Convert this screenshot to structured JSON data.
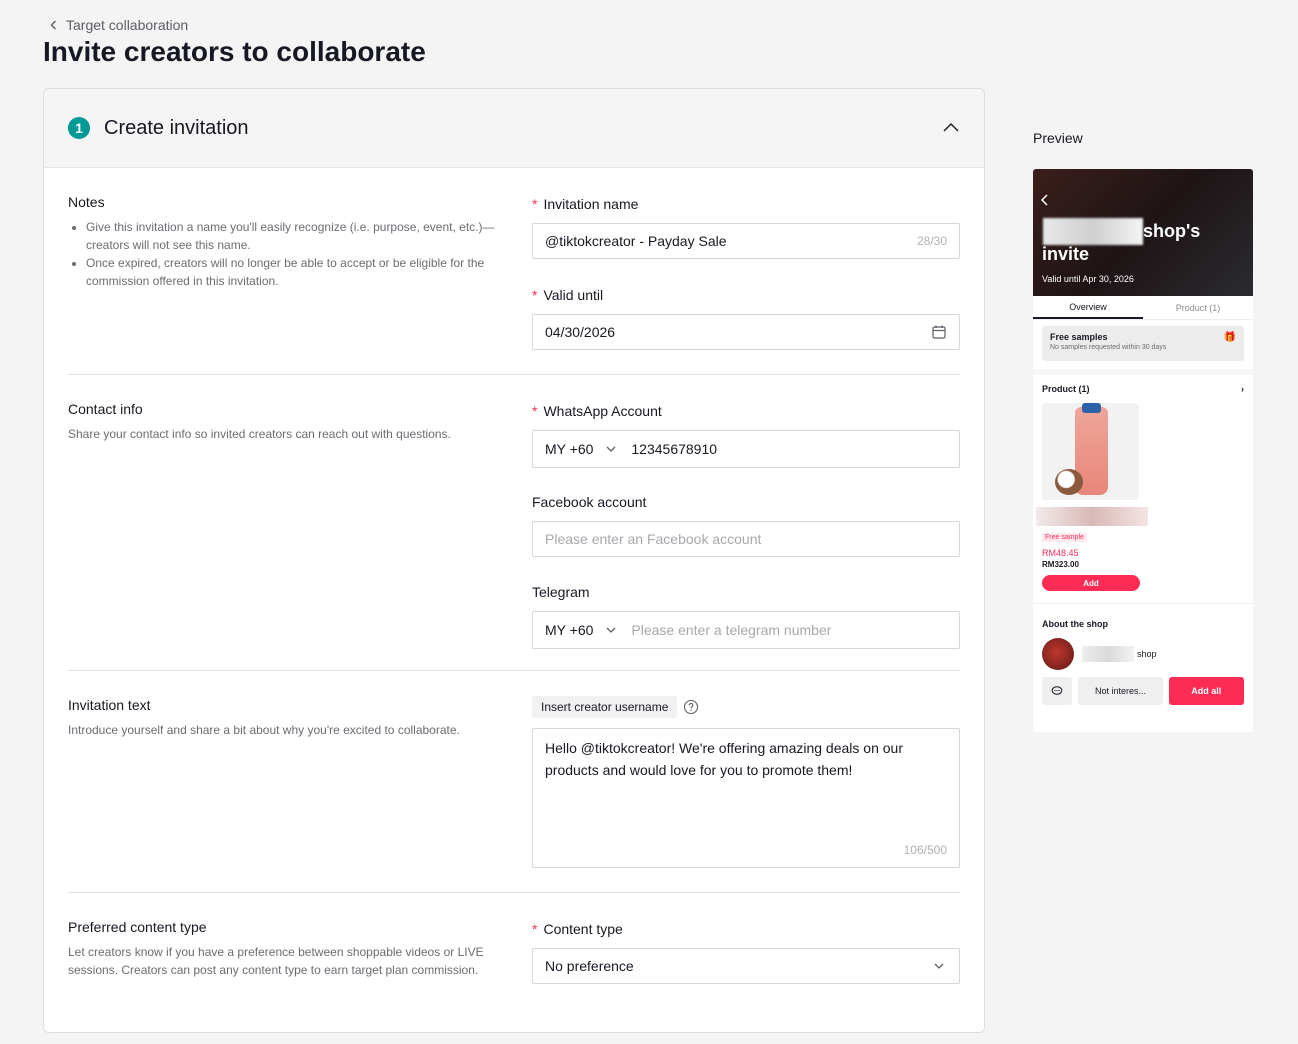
{
  "breadcrumb": {
    "label": "Target collaboration"
  },
  "page": {
    "title": "Invite creators to collaborate"
  },
  "card": {
    "step": "1",
    "title": "Create invitation"
  },
  "notes": {
    "title": "Notes",
    "bullets": [
      "Give this invitation a name you'll easily recognize (i.e. purpose, event, etc.)—creators will not see this name.",
      "Once expired, creators will no longer be able to accept or be eligible for the commission offered in this invitation."
    ]
  },
  "invitation_name": {
    "label": "Invitation name",
    "value": "@tiktokcreator - Payday Sale",
    "counter": "28/30"
  },
  "valid_until": {
    "label": "Valid until",
    "value": "04/30/2026"
  },
  "contact": {
    "title": "Contact info",
    "desc": "Share your contact info so invited creators can reach out with questions.",
    "whatsapp": {
      "label": "WhatsApp Account",
      "country": "MY +60",
      "value": "12345678910"
    },
    "facebook": {
      "label": "Facebook account",
      "placeholder": "Please enter an Facebook account"
    },
    "telegram": {
      "label": "Telegram",
      "country": "MY +60",
      "placeholder": "Please enter a telegram number"
    }
  },
  "invitation_text": {
    "title": "Invitation text",
    "desc": "Introduce yourself and share a bit about why you're excited to collaborate.",
    "insert_button": "Insert creator username",
    "value": "Hello @tiktokcreator! We're offering amazing deals on our products and would love for you to promote them!",
    "counter": "106/500"
  },
  "content_type": {
    "title": "Preferred content type",
    "desc": "Let creators know if you have a preference between shoppable videos or LIVE sessions. Creators can post any content type to earn target plan commission.",
    "label": "Content type",
    "value": "No preference"
  },
  "preview": {
    "label": "Preview",
    "shops": "shop's",
    "invite": "invite",
    "valid": "Valid until Apr 30, 2026",
    "tabs": [
      "Overview",
      "Product (1)"
    ],
    "free_samples_title": "Free samples",
    "free_samples_sub": "No samples requested within 30 days",
    "product_header": "Product (1)",
    "free_sample_tag": "Free sample",
    "price": "RM48.45",
    "orig_price": "RM323.00",
    "add": "Add",
    "about": "About the shop",
    "shop_suffix": "shop",
    "not_interested": "Not interes...",
    "add_all": "Add all"
  },
  "colors": {
    "accent": "#009995",
    "brand": "#fe2c55"
  }
}
